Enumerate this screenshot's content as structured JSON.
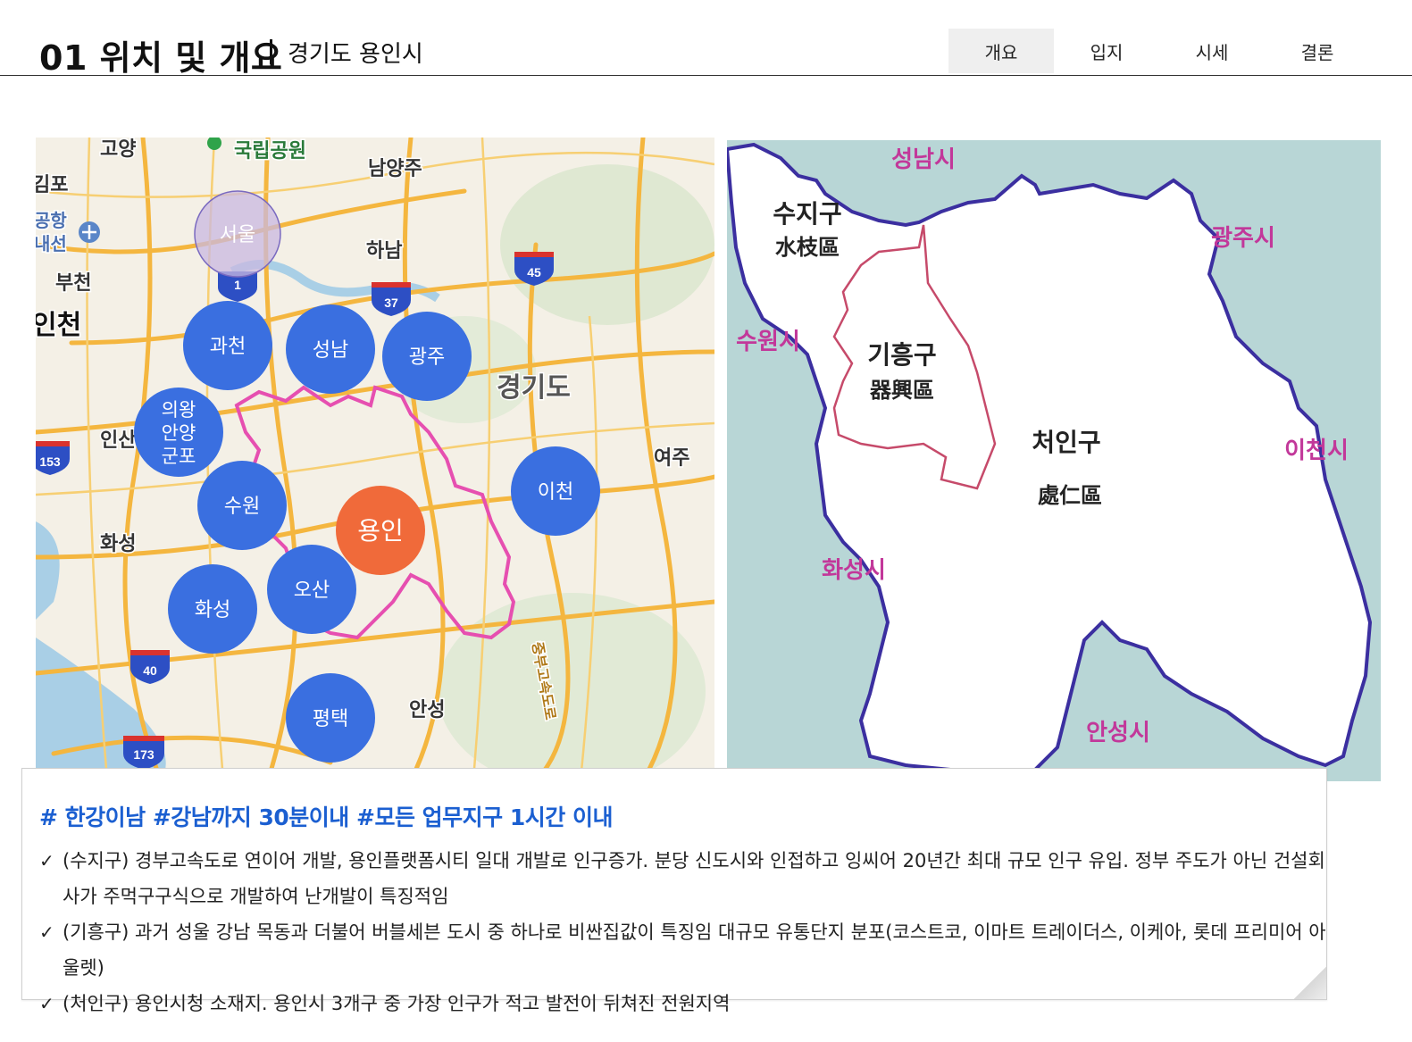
{
  "header": {
    "title": "01 위치 및 개요",
    "subtitle": "경기도 용인시",
    "tabs": [
      {
        "label": "개요",
        "active": true
      },
      {
        "label": "입지",
        "active": false
      },
      {
        "label": "시세",
        "active": false
      },
      {
        "label": "결론",
        "active": false
      }
    ]
  },
  "left_map": {
    "place_labels": [
      "고양",
      "국립공원",
      "남양주",
      "김포",
      "공항",
      "내선",
      "부천",
      "하남",
      "인천",
      "경기도",
      "여주",
      "인산",
      "화성",
      "안성",
      "중부고속도로"
    ],
    "highway_shields": [
      "1",
      "37",
      "45",
      "153",
      "40",
      "173"
    ],
    "circles": [
      {
        "label": "서울"
      },
      {
        "label": "과천"
      },
      {
        "label": "성남"
      },
      {
        "label": "광주"
      },
      {
        "label": "의왕\n안양\n군포"
      },
      {
        "label": "수원"
      },
      {
        "label": "이천"
      },
      {
        "label": "오산"
      },
      {
        "label": "화성"
      },
      {
        "label": "평택"
      },
      {
        "label": "용인",
        "highlight": true
      }
    ],
    "colors": {
      "circle": "#3a6fe0",
      "highlight": "#f06a3a",
      "boundary": "#e64fb0",
      "road": "#f4b63f"
    }
  },
  "right_map": {
    "neighbor_labels": [
      "성남시",
      "광주시",
      "수원시",
      "이천시",
      "화성시",
      "안성시"
    ],
    "districts": [
      {
        "name": "수지구",
        "hanja": "水枝區"
      },
      {
        "name": "기흥구",
        "hanja": "器興區"
      },
      {
        "name": "처인구",
        "hanja": "處仁區"
      }
    ],
    "colors": {
      "label": "#c2389a",
      "outline": "#3b2fa0",
      "inner_border": "#c64a6a",
      "water": "#b8d6d6"
    }
  },
  "summary": {
    "hashtags": "# 한강이남 #강남까지 30분이내 #모든 업무지구 1시간 이내",
    "bullets": [
      "(수지구) 경부고속도로 연이어 개발, 용인플랫폼시티 일대 개발로 인구증가. 분당 신도시와 인접하고 잉씨어 20년간 최대 규모 인구 유입. 정부 주도가 아닌 건설회사가 주먹구구식으로 개발하여 난개발이 특징적임",
      "(기흥구) 과거 성울 강남 목동과 더불어 버블세븐 도시 중 하나로 비싼집값이 특징임 대규모 유통단지 분포(코스트코, 이마트 트레이더스, 이케아, 롯데 프리미어 아울렛)",
      "(처인구) 용인시청 소재지. 용인시 3개구 중 가장 인구가 적고 발전이 뒤쳐진 전원지역"
    ]
  }
}
